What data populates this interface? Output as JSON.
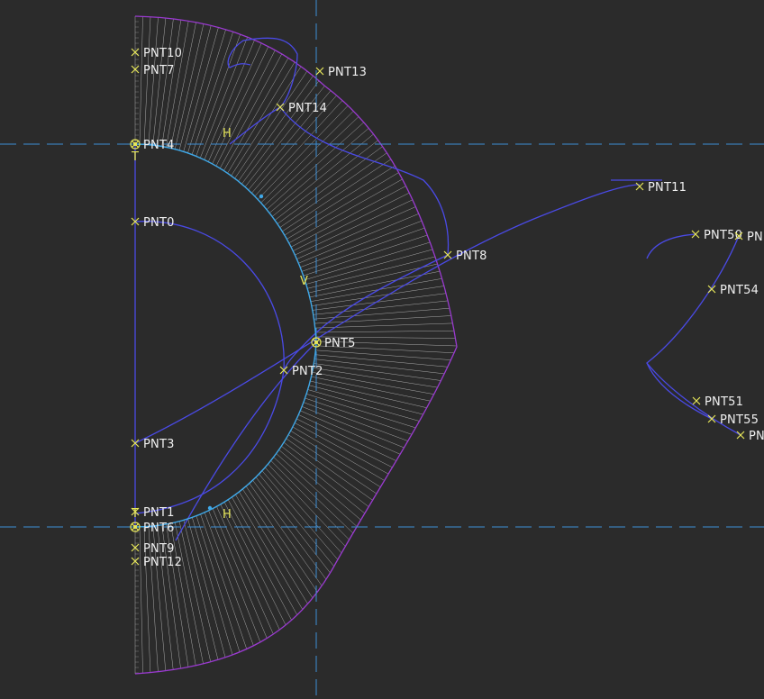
{
  "viewport": {
    "background": "#2b2b2b",
    "colors": {
      "point": "#e8e85a",
      "label": "#f0f0f0",
      "curve": "#4a4ae6",
      "sketch": "#3fa8e8",
      "boundary": "#9a3ad0",
      "hatch": "#c8c8c8",
      "axis": "#3d8fd6",
      "constraint": "#e8e85a"
    }
  },
  "points": [
    {
      "name": "PNT10"
    },
    {
      "name": "PNT7"
    },
    {
      "name": "PNT13"
    },
    {
      "name": "PNT14"
    },
    {
      "name": "PNT4"
    },
    {
      "name": "PNT0"
    },
    {
      "name": "PNT8"
    },
    {
      "name": "PNT11"
    },
    {
      "name": "PNT50"
    },
    {
      "name": "PN"
    },
    {
      "name": "PNT54"
    },
    {
      "name": "PNT5"
    },
    {
      "name": "PNT2"
    },
    {
      "name": "PNT51"
    },
    {
      "name": "PNT55"
    },
    {
      "name": "PN"
    },
    {
      "name": "PNT3"
    },
    {
      "name": "PNT1"
    },
    {
      "name": "PNT6"
    },
    {
      "name": "PNT9"
    },
    {
      "name": "PNT12"
    }
  ],
  "constraints": [
    {
      "label": "H"
    },
    {
      "label": "V"
    },
    {
      "label": "H"
    },
    {
      "label": "T"
    },
    {
      "label": "T"
    }
  ]
}
